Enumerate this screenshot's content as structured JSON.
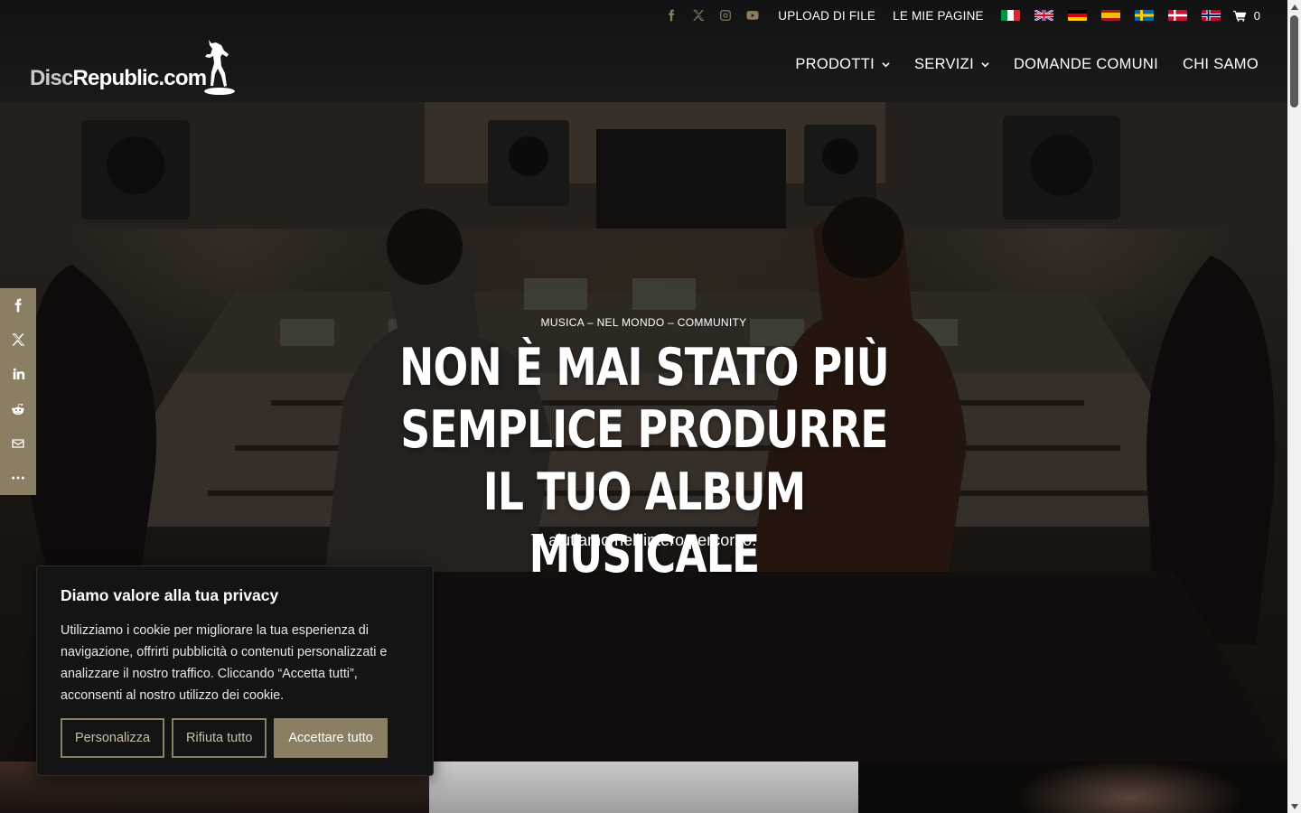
{
  "header": {
    "logo": {
      "disc": "Disc",
      "republic": "Republic.com"
    },
    "social_icons": [
      "facebook-icon",
      "x-twitter-icon",
      "instagram-icon",
      "youtube-icon"
    ],
    "top_links": [
      "UPLOAD DI FILE",
      "LE MIE PAGINE"
    ],
    "flags": [
      "italian",
      "english",
      "german",
      "spanish",
      "swedish",
      "danish",
      "norwegian"
    ],
    "cart_count": "0",
    "nav": [
      {
        "label": "PRODOTTI",
        "dropdown": true
      },
      {
        "label": "SERVIZI",
        "dropdown": true
      },
      {
        "label": "DOMANDE COMUNI",
        "dropdown": false
      },
      {
        "label": "CHI SAMO",
        "dropdown": false
      }
    ]
  },
  "hero": {
    "subtitle": "MUSICA – NEL MONDO – COMMUNITY",
    "title": "NON È MAI STATO PIÙ SEMPLICE PRODURRE IL TUO ALBUM MUSICALE",
    "tagline": "Ti aiutiamo nell’intero percorso."
  },
  "share_bar": [
    "facebook-icon",
    "x-twitter-icon",
    "linkedin-icon",
    "reddit-icon",
    "email-icon",
    "more-icon"
  ],
  "cookie": {
    "title": "Diamo valore alla tua privacy",
    "text": "Utilizziamo i cookie per migliorare la tua esperienza di navigazione, offrirti pubblicità o contenuti personalizzati e analizzare il nostro traffico. Cliccando “Accetta tutti”, acconsenti al nostro utilizzo dei cookie.",
    "buttons": {
      "customize": "Personalizza",
      "reject": "Rifiuta tutto",
      "accept": "Accettare tutto"
    }
  },
  "colors": {
    "accent": "#8a7e63",
    "header_bg": "#161616",
    "cookie_bg": "#141414"
  }
}
